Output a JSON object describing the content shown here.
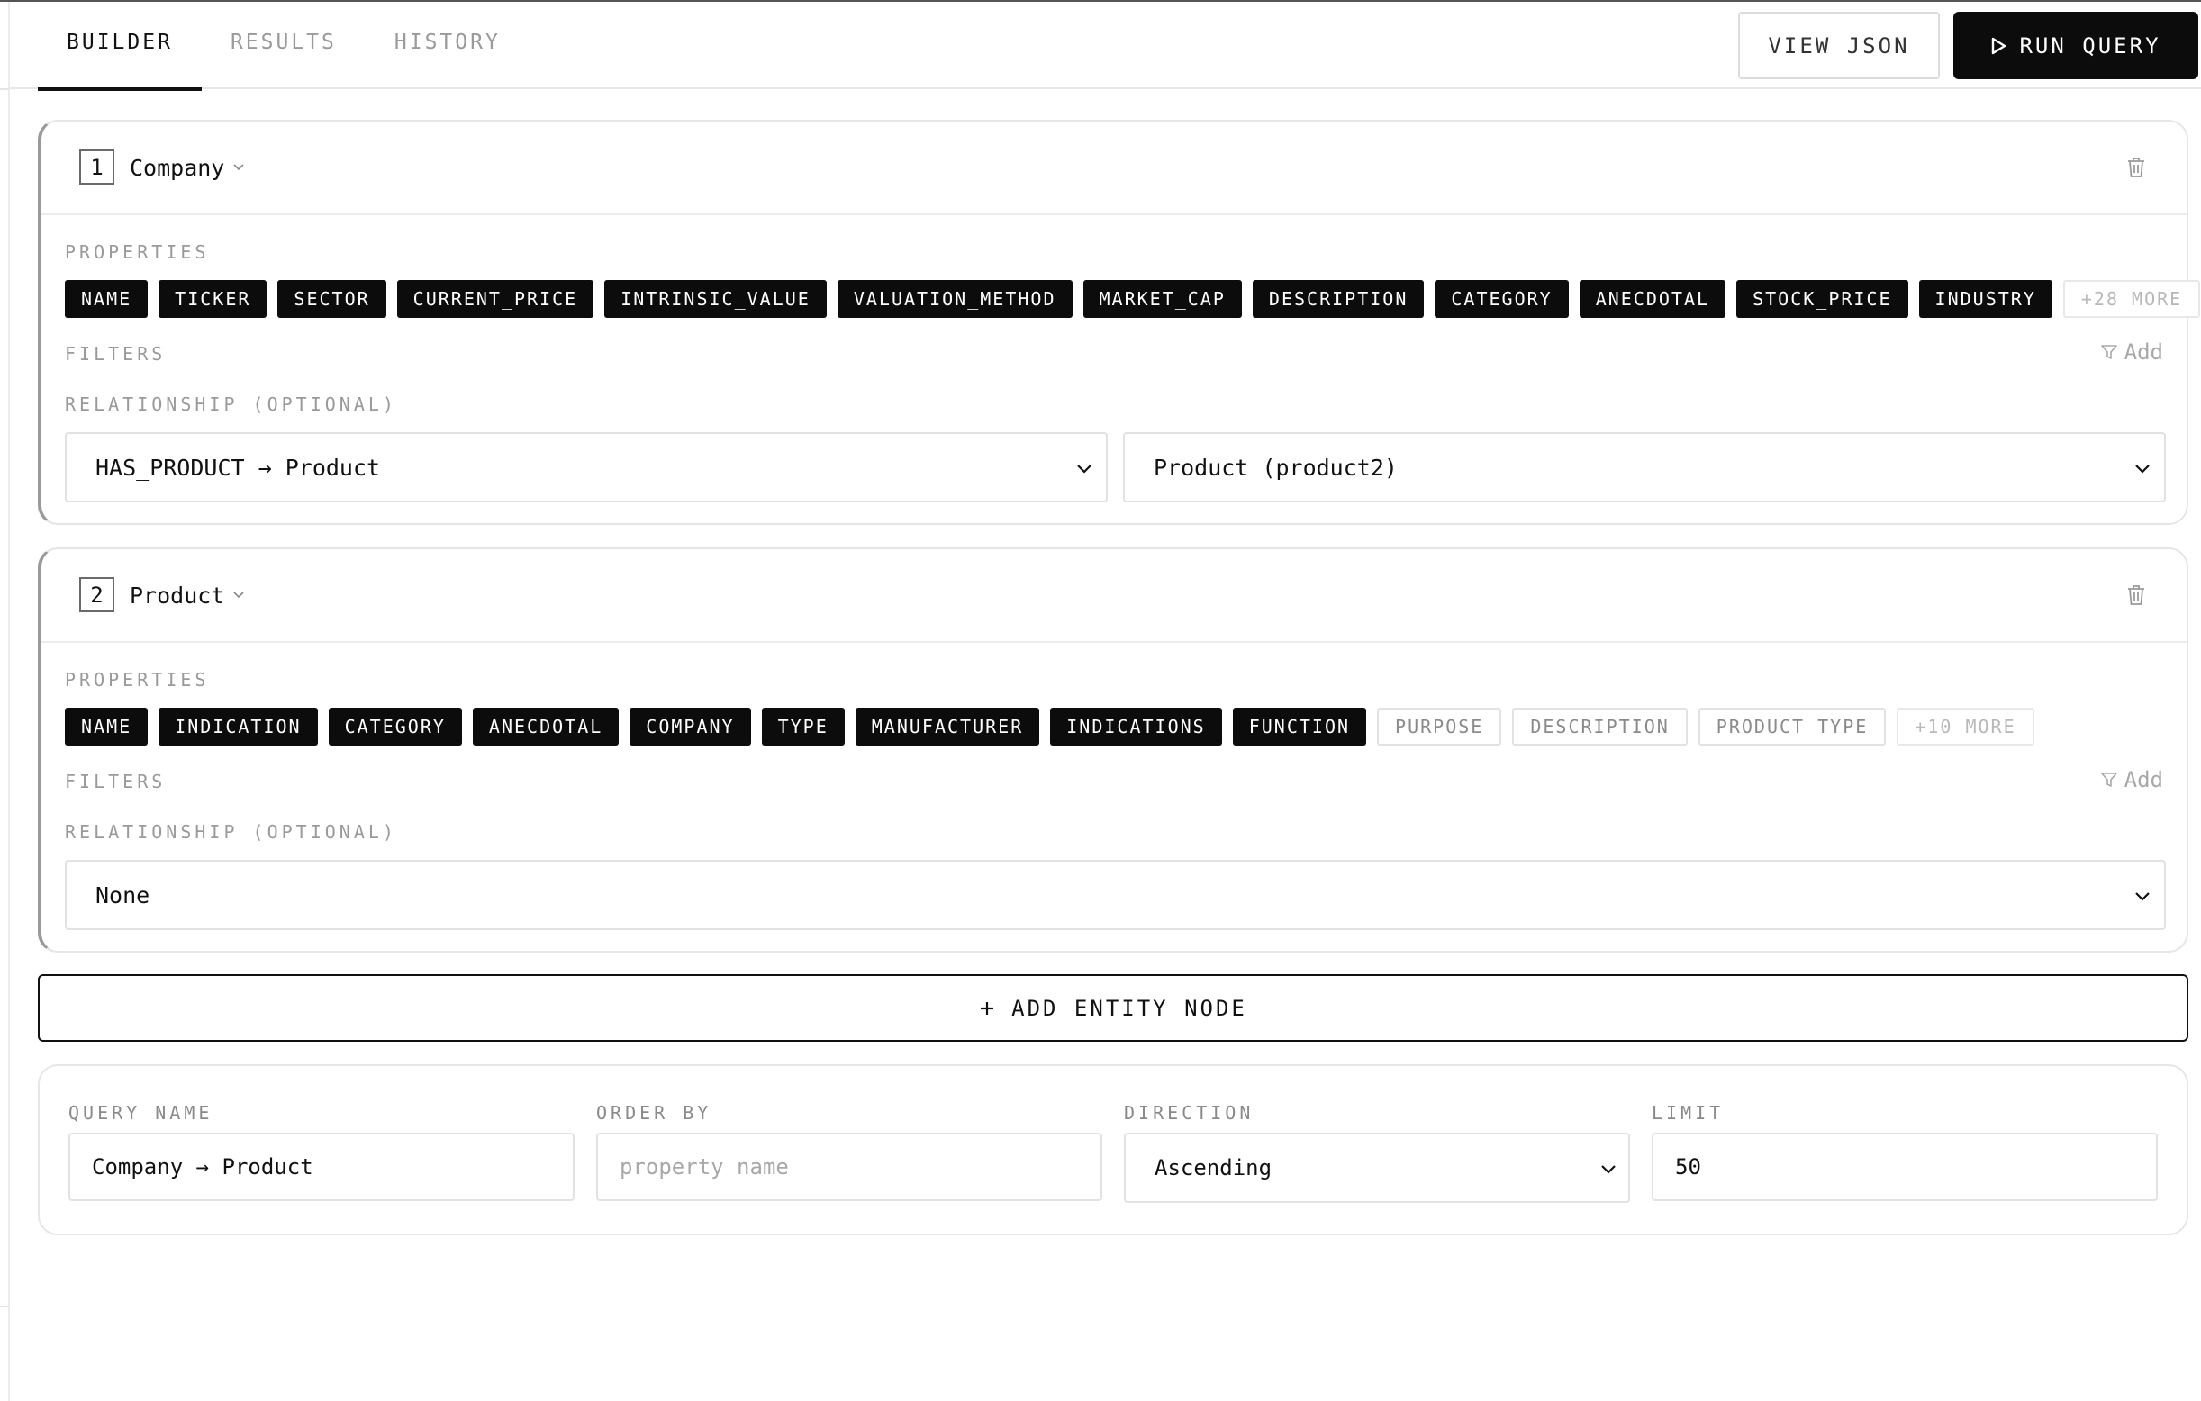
{
  "tabs": [
    {
      "label": "BUILDER",
      "active": true
    },
    {
      "label": "RESULTS",
      "active": false
    },
    {
      "label": "HISTORY",
      "active": false
    }
  ],
  "toolbar": {
    "view_json_label": "VIEW JSON",
    "run_query_label": "RUN QUERY"
  },
  "nodes": [
    {
      "index": "1",
      "entity": "Company",
      "properties_label": "PROPERTIES",
      "properties_selected": [
        "NAME",
        "TICKER",
        "SECTOR",
        "CURRENT_PRICE",
        "INTRINSIC_VALUE",
        "VALUATION_METHOD",
        "MARKET_CAP",
        "DESCRIPTION",
        "CATEGORY",
        "ANECDOTAL",
        "STOCK_PRICE",
        "INDUSTRY"
      ],
      "properties_unselected": [],
      "properties_more": "+28 MORE",
      "filters_label": "FILTERS",
      "add_filter_label": "Add",
      "relationship_label": "RELATIONSHIP (OPTIONAL)",
      "relationship_value": "HAS_PRODUCT → Product",
      "target_value": "Product (product2)"
    },
    {
      "index": "2",
      "entity": "Product",
      "properties_label": "PROPERTIES",
      "properties_selected": [
        "NAME",
        "INDICATION",
        "CATEGORY",
        "ANECDOTAL",
        "COMPANY",
        "TYPE",
        "MANUFACTURER",
        "INDICATIONS",
        "FUNCTION"
      ],
      "properties_unselected": [
        "PURPOSE",
        "DESCRIPTION",
        "PRODUCT_TYPE"
      ],
      "properties_more": "+10 MORE",
      "filters_label": "FILTERS",
      "add_filter_label": "Add",
      "relationship_label": "RELATIONSHIP (OPTIONAL)",
      "relationship_value": "None"
    }
  ],
  "add_node_label": "ADD ENTITY NODE",
  "settings": {
    "query_name": {
      "label": "QUERY NAME",
      "value": "Company → Product"
    },
    "order_by": {
      "label": "ORDER BY",
      "placeholder": "property name"
    },
    "direction": {
      "label": "DIRECTION",
      "value": "Ascending"
    },
    "limit": {
      "label": "LIMIT",
      "value": "50"
    }
  },
  "icons": {
    "play": "play-icon",
    "trash": "trash-icon",
    "filter": "filter-icon",
    "chevron": "chevron-down-icon",
    "plus": "plus-icon"
  }
}
